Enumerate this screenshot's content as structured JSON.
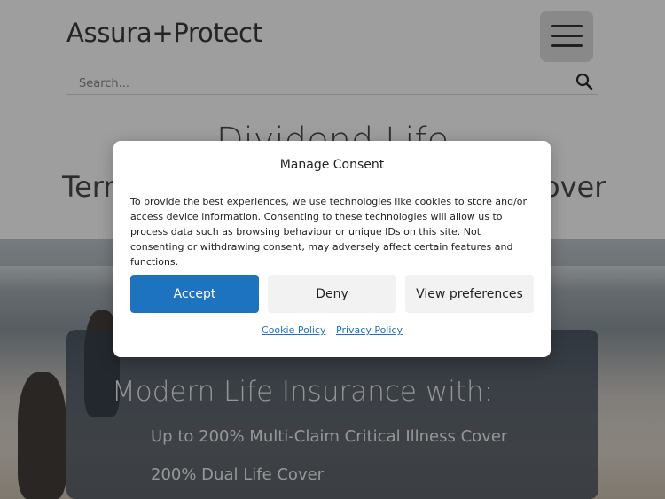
{
  "header": {
    "logo_text": "Assura+Protect",
    "menu_icon": "hamburger-menu-icon"
  },
  "search": {
    "placeholder": "Search...",
    "icon": "search-icon"
  },
  "hero": {
    "title": "Dividend Life",
    "subtitle_left": "Term",
    "subtitle_right": "over"
  },
  "panel": {
    "title": "Modern Life Insurance with:",
    "items": [
      "Up to 200% Multi-Claim Critical Illness Cover",
      "200% Dual Life Cover"
    ]
  },
  "consent": {
    "title": "Manage Consent",
    "body": "To provide the best experiences, we use technologies like cookies to store and/or access device information. Consenting to these technologies will allow us to process data such as browsing behaviour or unique IDs on this site. Not consenting or withdrawing consent, may adversely affect certain features and functions.",
    "accept_label": "Accept",
    "deny_label": "Deny",
    "prefs_label": "View preferences",
    "cookie_policy_label": "Cookie Policy",
    "privacy_policy_label": "Privacy Policy"
  },
  "colors": {
    "accent": "#1e73be",
    "overlay": "#282828"
  }
}
